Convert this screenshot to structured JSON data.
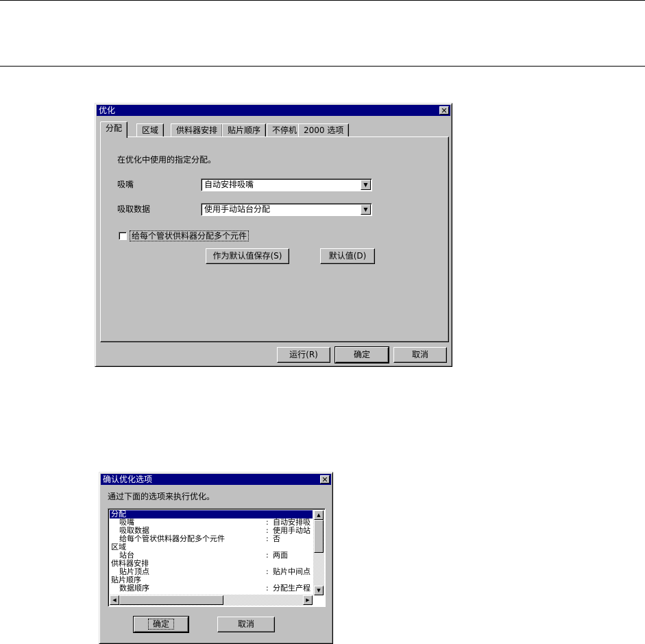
{
  "dialog1": {
    "title": "优化",
    "close": "✕",
    "tabs": [
      "分配",
      "区域",
      "供料器安排",
      "贴片顺序",
      "不停机",
      "2000 选项"
    ],
    "heading": "在优化中使用的指定分配。",
    "nozzle_label": "吸嘴",
    "nozzle_value": "自动安排吸嘴",
    "pickup_label": "吸取数据",
    "pickup_value": "使用手动站台分配",
    "multi_label": "给每个管状供料器分配多个元件",
    "multi_checked": false,
    "save_default": "作为默认值保存(S)",
    "default": "默认值(D)",
    "run": "运行(R)",
    "ok": "确定",
    "cancel": "取消",
    "arrow": "▼"
  },
  "dialog2": {
    "title": "确认优化选项",
    "close": "✕",
    "intro": "通过下面的选项来执行优化。",
    "rows": [
      {
        "name": "分配",
        "value": "",
        "indent": 0,
        "selected": true
      },
      {
        "name": "吸嘴",
        "value": "自动安排吸",
        "indent": 1
      },
      {
        "name": "吸取数据",
        "value": "使用手动站",
        "indent": 1
      },
      {
        "name": "给每个管状供料器分配多个元件",
        "value": "否",
        "indent": 1
      },
      {
        "name": "区域",
        "value": "",
        "indent": 0
      },
      {
        "name": "站台",
        "value": "两面",
        "indent": 1
      },
      {
        "name": "供料器安排",
        "value": "",
        "indent": 0
      },
      {
        "name": "贴片顶点",
        "value": "贴片中间点",
        "indent": 1
      },
      {
        "name": "贴片顺序",
        "value": "",
        "indent": 0
      },
      {
        "name": "数据顺序",
        "value": "分配生产程",
        "indent": 1
      }
    ],
    "colon": ":",
    "ok": "确定",
    "cancel": "取消",
    "up": "▲",
    "down": "▼",
    "left": "◀",
    "right": "▶"
  }
}
